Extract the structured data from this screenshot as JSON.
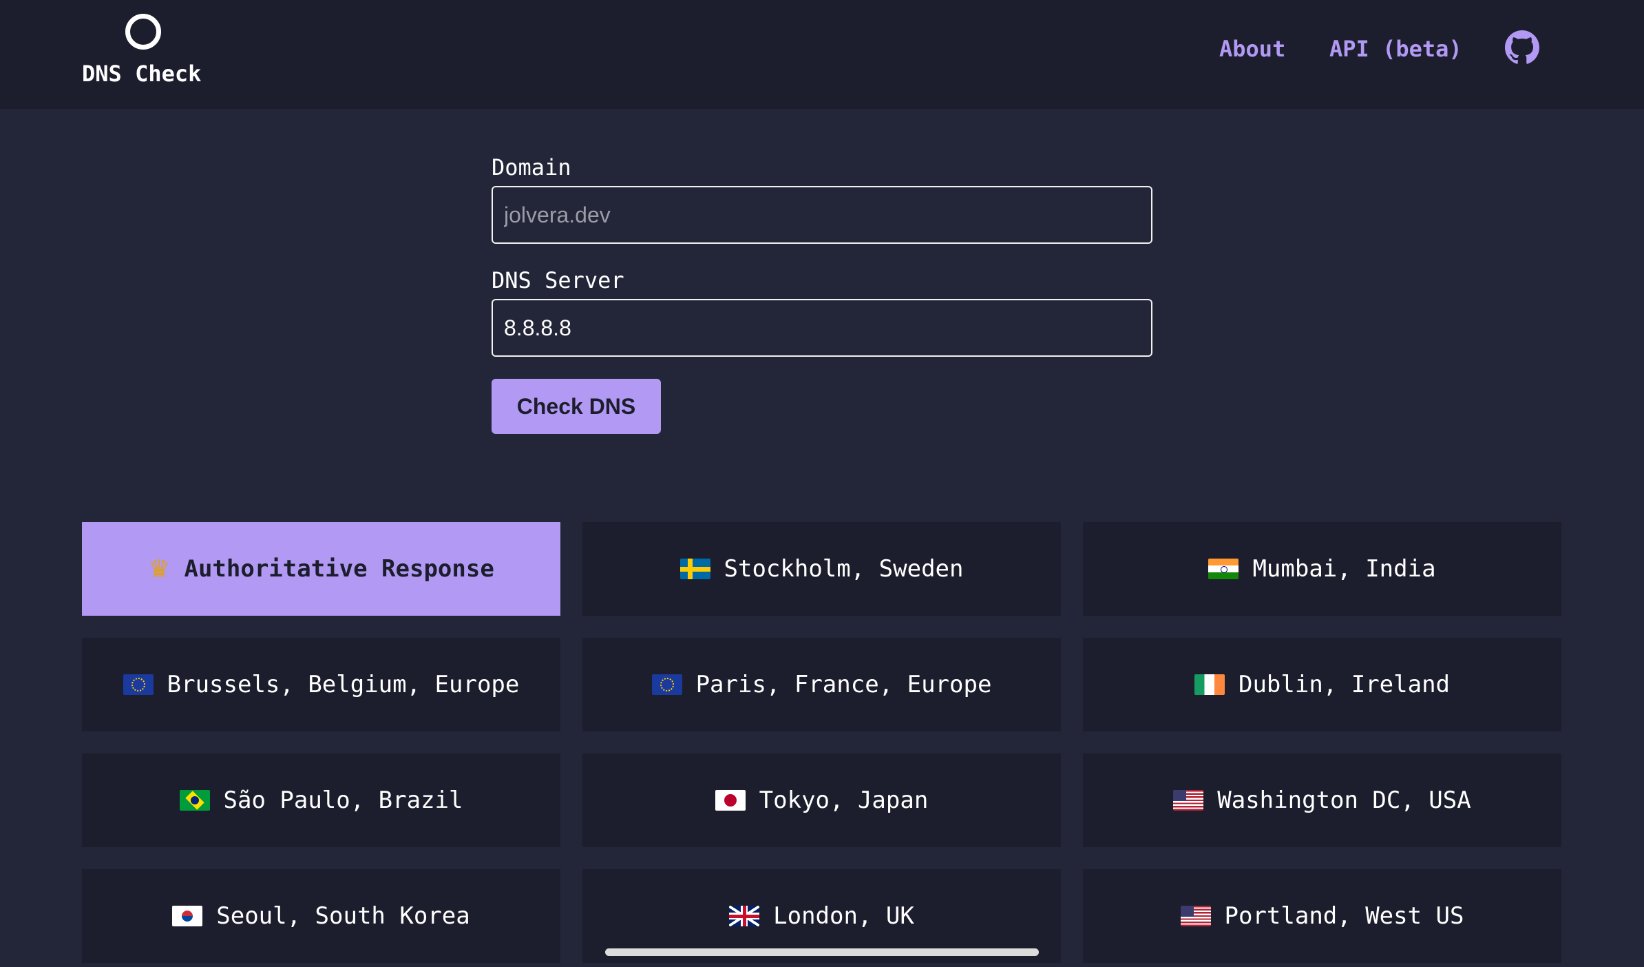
{
  "header": {
    "logo_text": "DNS Check",
    "nav": {
      "about": "About",
      "api": "API (beta)"
    },
    "github_icon": "github-icon"
  },
  "form": {
    "domain_label": "Domain",
    "domain_placeholder": "jolvera.dev",
    "domain_value": "",
    "dns_label": "DNS Server",
    "dns_value": "8.8.8.8",
    "submit_label": "Check DNS"
  },
  "locations": [
    {
      "label": "Authoritative Response",
      "icon": "crown-icon",
      "active": true
    },
    {
      "label": "Stockholm, Sweden",
      "icon": "flag-sweden-icon"
    },
    {
      "label": "Mumbai, India",
      "icon": "flag-india-icon"
    },
    {
      "label": "Brussels, Belgium, Europe",
      "icon": "flag-eu-icon"
    },
    {
      "label": "Paris, France, Europe",
      "icon": "flag-eu-icon"
    },
    {
      "label": "Dublin, Ireland",
      "icon": "flag-ireland-icon"
    },
    {
      "label": "São Paulo, Brazil",
      "icon": "flag-brazil-icon"
    },
    {
      "label": "Tokyo, Japan",
      "icon": "flag-japan-icon"
    },
    {
      "label": "Washington DC, USA",
      "icon": "flag-usa-icon"
    },
    {
      "label": "Seoul, South Korea",
      "icon": "flag-south-korea-icon"
    },
    {
      "label": "London, UK",
      "icon": "flag-uk-icon"
    },
    {
      "label": "Portland, West US",
      "icon": "flag-usa-icon"
    }
  ],
  "colors": {
    "accent": "#b29af4",
    "background": "#232638",
    "surface": "#1c1e2d"
  }
}
